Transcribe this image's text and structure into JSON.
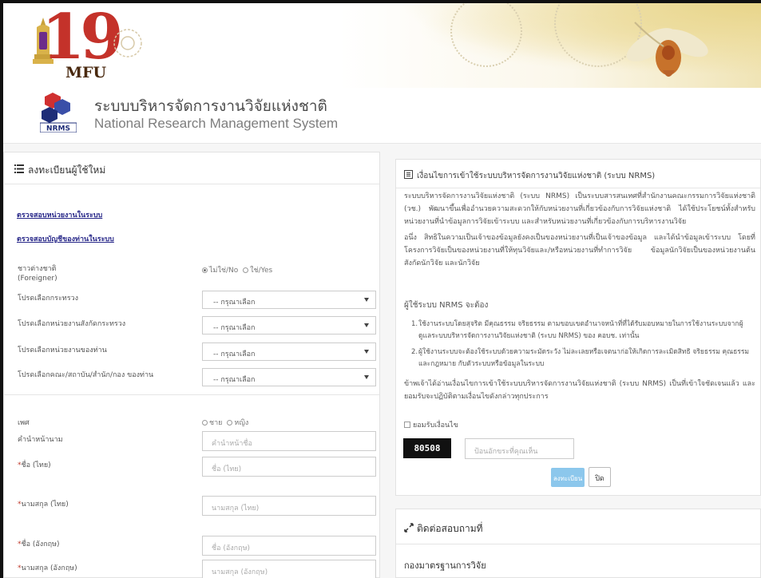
{
  "logo": {
    "number": "19",
    "abbr": "MFU"
  },
  "system": {
    "title_th": "ระบบบริหารจัดการงานวิจัยแห่งชาติ",
    "title_en": "National Research Management System",
    "logo_text": "NRMS"
  },
  "register": {
    "header": "ลงทะเบียนผู้ใช้ใหม่",
    "link_check_unit": "ตรวจสอบหน่วยงานในระบบ",
    "link_check_account": "ตรวจสอบบัญชีของท่านในระบบ",
    "foreigner_label": "ชาวต่างชาติ",
    "foreigner_label_en": "(Foreigner)",
    "foreigner_no": "ไม่ใช่/No",
    "foreigner_yes": "ใช่/Yes",
    "ministry_label": "โปรดเลือกกระทรวง",
    "subunit_label": "โปรดเลือกหน่วยงานสังกัดกระทรวง",
    "unit_label": "โปรดเลือกหน่วยงานของท่าน",
    "faculty_label": "โปรดเลือกคณะ/สถาบัน/สำนัก/กอง ของท่าน",
    "select_placeholder": "-- กรุณาเลือก",
    "gender_label": "เพศ",
    "gender_male": "ชาย",
    "gender_female": "หญิง",
    "prefix_label": "คำนำหน้านาม",
    "prefix_placeholder": "คำนำหน้าชื่อ",
    "firstname_th_label": "ชื่อ (ไทย)",
    "firstname_th_placeholder": "ชื่อ (ไทย)",
    "lastname_th_label": "นามสกุล (ไทย)",
    "lastname_th_placeholder": "นามสกุล (ไทย)",
    "firstname_en_label": "ชื่อ (อังกฤษ)",
    "firstname_en_placeholder": "ชื่อ (อังกฤษ)",
    "lastname_en_label": "นามสกุล (อังกฤษ)",
    "lastname_en_placeholder": "นามสกุล (อังกฤษ)",
    "required_mark": "*"
  },
  "terms": {
    "header": "เงื่อนไขการเข้าใช้ระบบบริหารจัดการงานวิจัยแห่งชาติ (ระบบ NRMS)",
    "para1": "ระบบบริหารจัดการงานวิจัยแห่งชาติ (ระบบ NRMS) เป็นระบบสารสนเทศที่สำนักงานคณะกรรมการวิจัยแห่งชาติ (วช.) พัฒนาขึ้นเพื่ออำนวยความสะดวกให้กับหน่วยงานที่เกี่ยวข้องกับการวิจัยแห่งชาติ ได้ใช้ประโยชน์ทั้งสำหรับหน่วยงานที่นำข้อมูลการวิจัยเข้าระบบ และสำหรับหน่วยงานที่เกี่ยวข้องกับการบริหารงานวิจัย",
    "para2": "อนึ่ง สิทธิในความเป็นเจ้าของข้อมูลยังคงเป็นของหน่วยงานที่เป็นเจ้าของข้อมูล และได้นำข้อมูลเข้าระบบ โดยที่โครงการวิจัยเป็นของหน่วยงานที่ให้ทุนวิจัยและ/หรือหน่วยงานที่ทำการวิจัย ข้อมูลนักวิจัยเป็นของหน่วยงานต้นสังกัดนักวิจัย และนักวิจัย",
    "users_must": "ผู้ใช้ระบบ NRMS จะต้อง",
    "item1": "ใช้งานระบบโดยสุจริต มีคุณธรรม จริยธรรม ตามขอบเขตอำนาจหน้าที่ที่ได้รับมอบหมายในการใช้งานระบบจากผู้ดูแลระบบบริหารจัดการงานวิจัยแห่งชาติ (ระบบ NRMS) ของ คอบช. เท่านั้น",
    "item2": "ผู้ใช้งานระบบจะต้องใช้ระบบด้วยความระมัดระวัง ไม่ละเลยหรือเจตนาก่อให้เกิดการละเมิดสิทธิ จริยธรรม คุณธรรม และกฎหมาย กับตัวระบบหรือข้อมูลในระบบ",
    "para3": "ข้าพเจ้าได้อ่านเงื่อนไขการเข้าใช้ระบบบริหารจัดการงานวิจัยแห่งชาติ (ระบบ NRMS) เป็นที่เข้าใจชัดเจนแล้ว และยอมรับจะปฏิบัติตามเงื่อนไขดังกล่าวทุกประการ",
    "accept": "ยอมรับเงื่อนไข",
    "captcha_code": "80508",
    "captcha_placeholder": "ป้อนอักขระที่คุณเห็น",
    "submit": "ลงทะเบียน",
    "close": "ปิด"
  },
  "contact": {
    "header": "ติดต่อสอบถามที่",
    "dept": "กองมาตรฐานการวิจัย"
  },
  "colors": {
    "logo_red": "#c4322a",
    "link": "#2a2a8a",
    "submit_bg": "#8cc7ec",
    "captcha_bg": "#111111"
  },
  "icons": [
    "list-icon",
    "document-icon",
    "expand-arrows-icon",
    "caret-down-icon"
  ]
}
